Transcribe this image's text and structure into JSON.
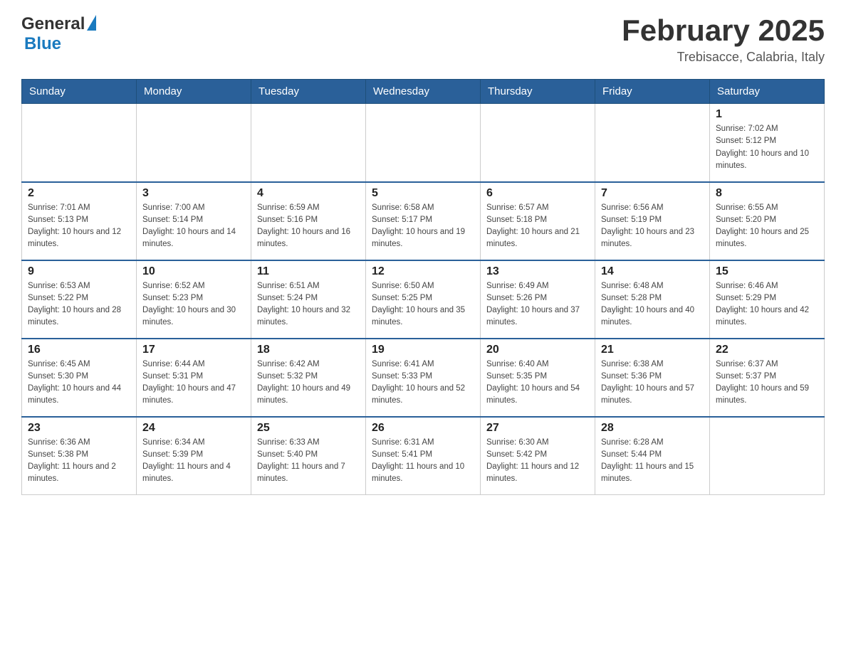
{
  "header": {
    "logo_general": "General",
    "logo_blue": "Blue",
    "title": "February 2025",
    "subtitle": "Trebisacce, Calabria, Italy"
  },
  "days_of_week": [
    "Sunday",
    "Monday",
    "Tuesday",
    "Wednesday",
    "Thursday",
    "Friday",
    "Saturday"
  ],
  "weeks": [
    {
      "days": [
        {
          "number": "",
          "info": ""
        },
        {
          "number": "",
          "info": ""
        },
        {
          "number": "",
          "info": ""
        },
        {
          "number": "",
          "info": ""
        },
        {
          "number": "",
          "info": ""
        },
        {
          "number": "",
          "info": ""
        },
        {
          "number": "1",
          "info": "Sunrise: 7:02 AM\nSunset: 5:12 PM\nDaylight: 10 hours and 10 minutes."
        }
      ]
    },
    {
      "days": [
        {
          "number": "2",
          "info": "Sunrise: 7:01 AM\nSunset: 5:13 PM\nDaylight: 10 hours and 12 minutes."
        },
        {
          "number": "3",
          "info": "Sunrise: 7:00 AM\nSunset: 5:14 PM\nDaylight: 10 hours and 14 minutes."
        },
        {
          "number": "4",
          "info": "Sunrise: 6:59 AM\nSunset: 5:16 PM\nDaylight: 10 hours and 16 minutes."
        },
        {
          "number": "5",
          "info": "Sunrise: 6:58 AM\nSunset: 5:17 PM\nDaylight: 10 hours and 19 minutes."
        },
        {
          "number": "6",
          "info": "Sunrise: 6:57 AM\nSunset: 5:18 PM\nDaylight: 10 hours and 21 minutes."
        },
        {
          "number": "7",
          "info": "Sunrise: 6:56 AM\nSunset: 5:19 PM\nDaylight: 10 hours and 23 minutes."
        },
        {
          "number": "8",
          "info": "Sunrise: 6:55 AM\nSunset: 5:20 PM\nDaylight: 10 hours and 25 minutes."
        }
      ]
    },
    {
      "days": [
        {
          "number": "9",
          "info": "Sunrise: 6:53 AM\nSunset: 5:22 PM\nDaylight: 10 hours and 28 minutes."
        },
        {
          "number": "10",
          "info": "Sunrise: 6:52 AM\nSunset: 5:23 PM\nDaylight: 10 hours and 30 minutes."
        },
        {
          "number": "11",
          "info": "Sunrise: 6:51 AM\nSunset: 5:24 PM\nDaylight: 10 hours and 32 minutes."
        },
        {
          "number": "12",
          "info": "Sunrise: 6:50 AM\nSunset: 5:25 PM\nDaylight: 10 hours and 35 minutes."
        },
        {
          "number": "13",
          "info": "Sunrise: 6:49 AM\nSunset: 5:26 PM\nDaylight: 10 hours and 37 minutes."
        },
        {
          "number": "14",
          "info": "Sunrise: 6:48 AM\nSunset: 5:28 PM\nDaylight: 10 hours and 40 minutes."
        },
        {
          "number": "15",
          "info": "Sunrise: 6:46 AM\nSunset: 5:29 PM\nDaylight: 10 hours and 42 minutes."
        }
      ]
    },
    {
      "days": [
        {
          "number": "16",
          "info": "Sunrise: 6:45 AM\nSunset: 5:30 PM\nDaylight: 10 hours and 44 minutes."
        },
        {
          "number": "17",
          "info": "Sunrise: 6:44 AM\nSunset: 5:31 PM\nDaylight: 10 hours and 47 minutes."
        },
        {
          "number": "18",
          "info": "Sunrise: 6:42 AM\nSunset: 5:32 PM\nDaylight: 10 hours and 49 minutes."
        },
        {
          "number": "19",
          "info": "Sunrise: 6:41 AM\nSunset: 5:33 PM\nDaylight: 10 hours and 52 minutes."
        },
        {
          "number": "20",
          "info": "Sunrise: 6:40 AM\nSunset: 5:35 PM\nDaylight: 10 hours and 54 minutes."
        },
        {
          "number": "21",
          "info": "Sunrise: 6:38 AM\nSunset: 5:36 PM\nDaylight: 10 hours and 57 minutes."
        },
        {
          "number": "22",
          "info": "Sunrise: 6:37 AM\nSunset: 5:37 PM\nDaylight: 10 hours and 59 minutes."
        }
      ]
    },
    {
      "days": [
        {
          "number": "23",
          "info": "Sunrise: 6:36 AM\nSunset: 5:38 PM\nDaylight: 11 hours and 2 minutes."
        },
        {
          "number": "24",
          "info": "Sunrise: 6:34 AM\nSunset: 5:39 PM\nDaylight: 11 hours and 4 minutes."
        },
        {
          "number": "25",
          "info": "Sunrise: 6:33 AM\nSunset: 5:40 PM\nDaylight: 11 hours and 7 minutes."
        },
        {
          "number": "26",
          "info": "Sunrise: 6:31 AM\nSunset: 5:41 PM\nDaylight: 11 hours and 10 minutes."
        },
        {
          "number": "27",
          "info": "Sunrise: 6:30 AM\nSunset: 5:42 PM\nDaylight: 11 hours and 12 minutes."
        },
        {
          "number": "28",
          "info": "Sunrise: 6:28 AM\nSunset: 5:44 PM\nDaylight: 11 hours and 15 minutes."
        },
        {
          "number": "",
          "info": ""
        }
      ]
    }
  ]
}
